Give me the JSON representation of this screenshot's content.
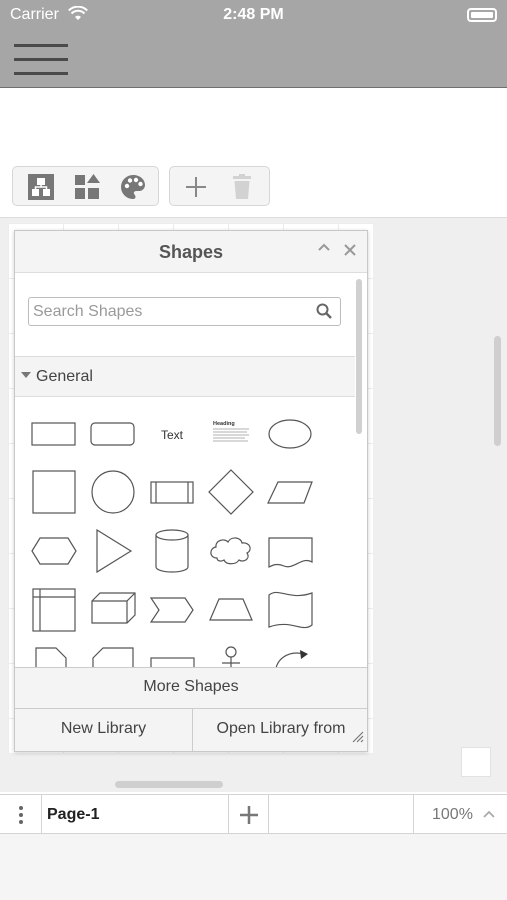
{
  "status_bar": {
    "carrier": "Carrier",
    "time": "2:48 PM"
  },
  "toolbar": {
    "icons": [
      "format-panel-icon",
      "shapes-panel-icon",
      "style-palette-icon",
      "add-icon",
      "delete-icon"
    ]
  },
  "shapes_panel": {
    "title": "Shapes",
    "search_placeholder": "Search Shapes",
    "section_label": "General",
    "text_shape_label": "Text",
    "heading_shape_label": "Heading",
    "more_shapes_label": "More Shapes",
    "new_library_label": "New Library",
    "open_library_label": "Open Library from"
  },
  "footer": {
    "page_name": "Page-1",
    "zoom": "100%"
  },
  "colors": {
    "header_bg": "#a6a6a6",
    "panel_bg": "#f4f4f4",
    "canvas_bg": "#efefef"
  }
}
